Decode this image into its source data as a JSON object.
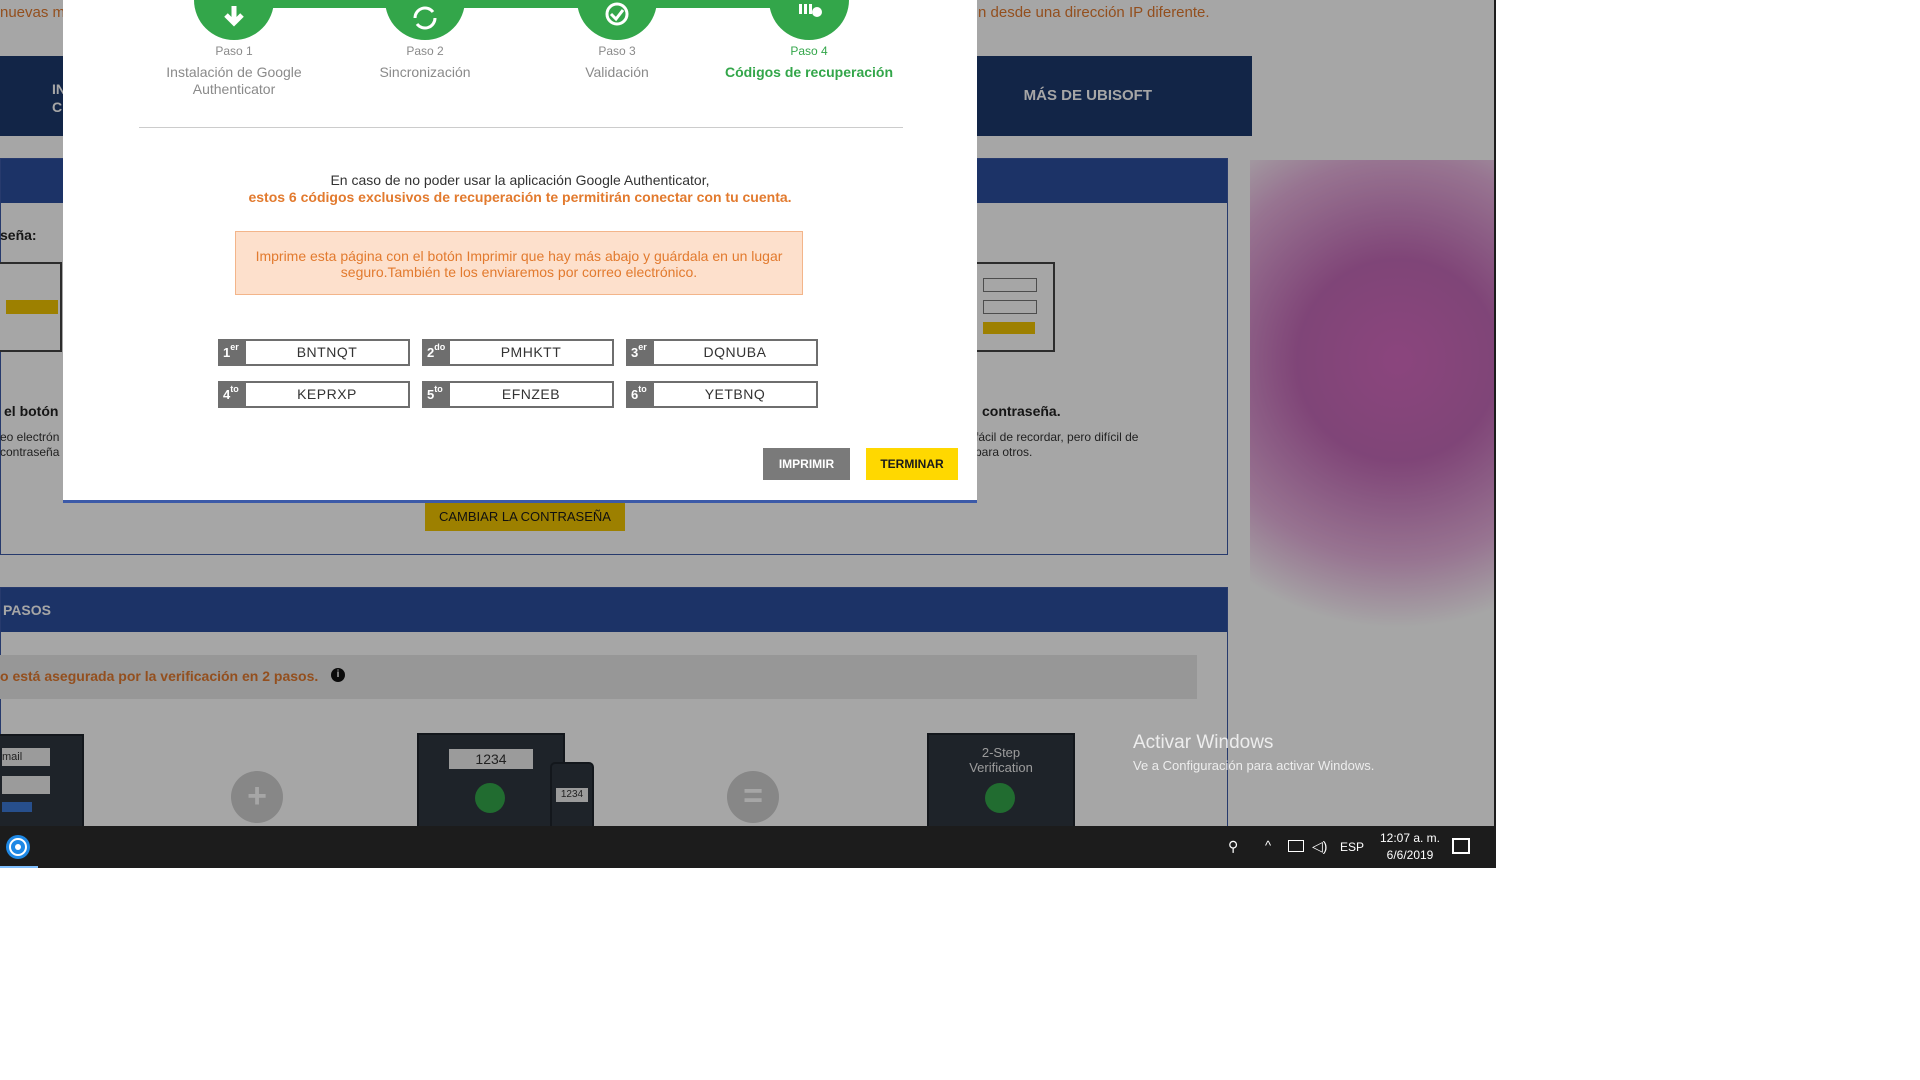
{
  "background": {
    "top_notice_left": "nuevas m",
    "top_notice_right": "n desde una dirección IP diferente.",
    "nav_stub": "IN\nC",
    "nav_more": "MÁS DE UBISOFT",
    "panel1_label": "seña:",
    "panel1_left_caption": "el botón",
    "panel1_left_small": "eo electrón\ncontraseña",
    "panel1_right_caption": "contraseña.",
    "panel1_right_small": "fácil de recordar, pero difícil de\npara otros.",
    "change_password_button": "CAMBIAR LA CONTRASEÑA",
    "panel2_title": "PASOS",
    "panel2_notice": "o está asegurada por la verificación en 2 pasos.",
    "monitor_code": "1234",
    "phone_code": "1234",
    "monitor_email": "mail",
    "two_step_label": "2-Step\nVerification",
    "activate_title": "Activar Windows",
    "activate_sub": "Ve a Configuración para activar Windows."
  },
  "modal": {
    "steps": [
      {
        "num": "Paso 1",
        "name": "Instalación de Google Authenticator",
        "icon": "download-icon"
      },
      {
        "num": "Paso 2",
        "name": "Sincronización",
        "icon": "sync-icon"
      },
      {
        "num": "Paso 3",
        "name": "Validación",
        "icon": "check-icon"
      },
      {
        "num": "Paso 4",
        "name": "Códigos de recuperación",
        "icon": "codes-icon",
        "active": true
      }
    ],
    "intro_line1": "En caso de no poder usar la aplicación Google Authenticator,",
    "intro_line2": "estos 6 códigos exclusivos de recuperación te permitirán conectar con tu cuenta.",
    "warning": "Imprime esta página con el botón Imprimir que hay más abajo y guárdala en un lugar seguro.También te los enviaremos por correo electrónico.",
    "codes": [
      {
        "n": "1",
        "sup": "er",
        "value": "BNTNQT"
      },
      {
        "n": "2",
        "sup": "do",
        "value": "PMHKTT"
      },
      {
        "n": "3",
        "sup": "er",
        "value": "DQNUBA"
      },
      {
        "n": "4",
        "sup": "to",
        "value": "KEPRXP"
      },
      {
        "n": "5",
        "sup": "to",
        "value": "EFNZEB"
      },
      {
        "n": "6",
        "sup": "to",
        "value": "YETBNQ"
      }
    ],
    "print_button": "IMPRIMIR",
    "finish_button": "TERMINAR"
  },
  "taskbar": {
    "language": "ESP",
    "time": "12:07 a. m.",
    "date": "6/6/2019"
  },
  "colors": {
    "accent_green": "#33a64a",
    "accent_orange": "#e27a2e",
    "button_yellow": "#ffd800",
    "nav_blue": "#1c3a6e"
  }
}
